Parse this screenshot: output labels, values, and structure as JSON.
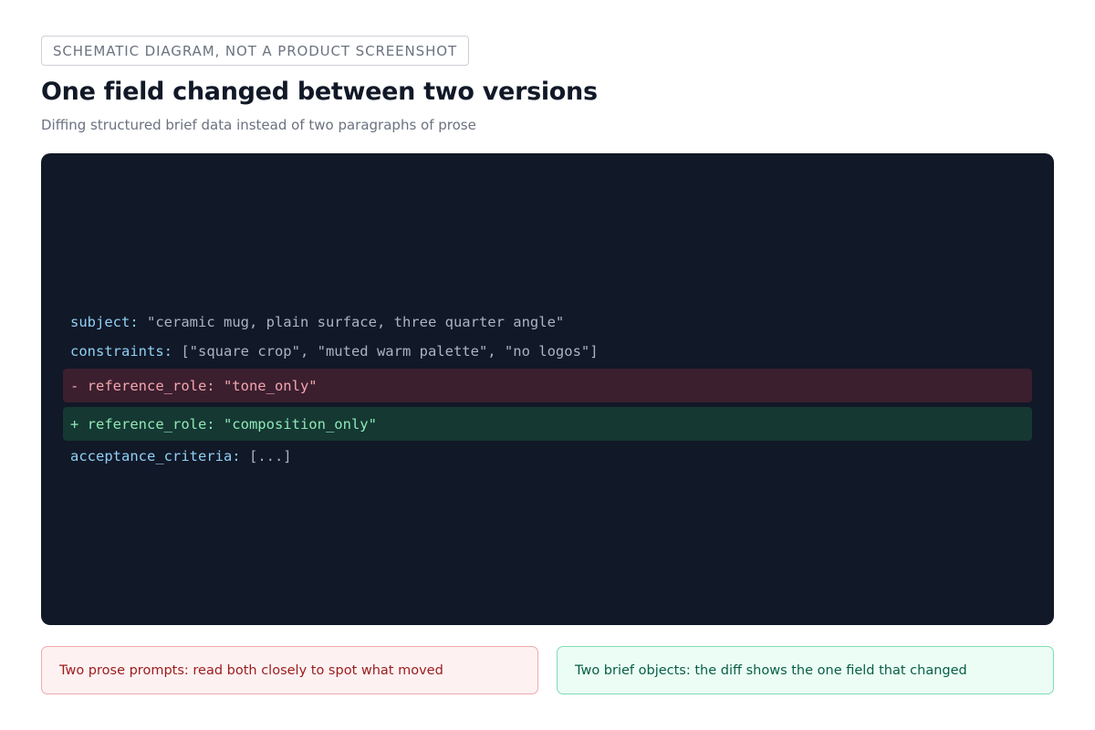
{
  "tag": "SCHEMATIC DIAGRAM, NOT A PRODUCT SCREENSHOT",
  "title": "One field changed between two versions",
  "subtitle": "Diffing structured brief data instead of two paragraphs of prose",
  "code": {
    "subject_key": "subject:",
    "subject_value": "\"ceramic mug, plain surface, three quarter angle\"",
    "constraints_key": "constraints:",
    "constraints_value": "[\"square crop\", \"muted warm palette\", \"no logos\"]",
    "removed_line": "- reference_role: \"tone_only\"",
    "added_line": "+ reference_role: \"composition_only\"",
    "acceptance_key": "acceptance_criteria:",
    "acceptance_value": "[...]"
  },
  "notes": {
    "prose": "Two prose prompts: read both closely to spot what moved",
    "brief": "Two brief objects: the diff shows the one field that changed"
  },
  "colors": {
    "panel_bg": "#111827",
    "key": "#8fd0f5",
    "removed_bg": "#3b1f2f",
    "removed_text": "#f4a5ae",
    "added_bg": "#153832",
    "added_text": "#8ee8b8"
  }
}
